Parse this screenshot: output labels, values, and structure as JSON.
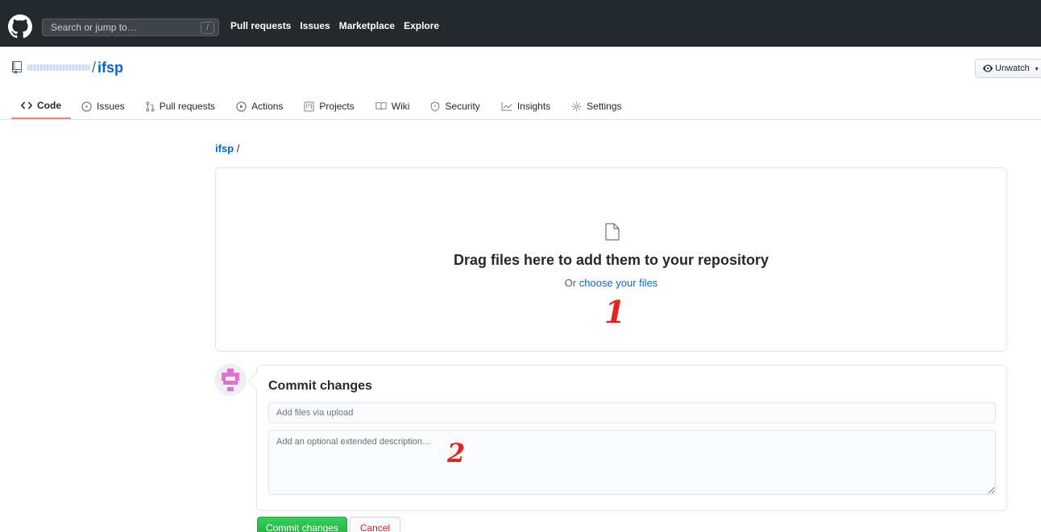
{
  "header": {
    "search_placeholder": "Search or jump to…",
    "search_shortcut": "/",
    "nav": [
      "Pull requests",
      "Issues",
      "Marketplace",
      "Explore"
    ]
  },
  "repo": {
    "separator": "/",
    "name": "ifsp",
    "watch_label": "Unwatch"
  },
  "tabs": [
    {
      "label": "Code",
      "icon": "code-icon",
      "selected": true
    },
    {
      "label": "Issues",
      "icon": "issue-opened-icon"
    },
    {
      "label": "Pull requests",
      "icon": "git-pull-request-icon"
    },
    {
      "label": "Actions",
      "icon": "play-icon"
    },
    {
      "label": "Projects",
      "icon": "project-icon"
    },
    {
      "label": "Wiki",
      "icon": "book-icon"
    },
    {
      "label": "Security",
      "icon": "shield-icon"
    },
    {
      "label": "Insights",
      "icon": "graph-icon"
    },
    {
      "label": "Settings",
      "icon": "gear-icon"
    }
  ],
  "breadcrumb": {
    "repo": "ifsp",
    "separator": "/"
  },
  "dropzone": {
    "title": "Drag files here to add them to your repository",
    "sub_prefix": "Or",
    "sub_link": "choose your files",
    "annotation": "1"
  },
  "commit": {
    "title": "Commit changes",
    "message_placeholder": "Add files via upload",
    "description_placeholder": "Add an optional extended description…",
    "annotation": "2",
    "commit_button": "Commit changes",
    "cancel_button": "Cancel"
  },
  "colors": {
    "header_bg": "#24292e",
    "link": "#0366d6",
    "selected_tab_underline": "#f9826c",
    "commit_green": "#28a745",
    "cancel_red": "#cb2431",
    "annotation_red": "#e8231b"
  }
}
